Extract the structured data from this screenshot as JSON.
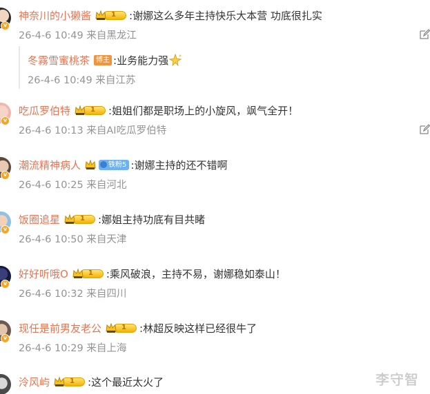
{
  "comments": [
    {
      "user": "神奈川的小獭酱",
      "level": "1",
      "text": ":谢娜这么多年主持快乐大本营 功底很扎实",
      "time": "26-4-6 10:49",
      "location": "来自黑龙江",
      "reply": {
        "user": "冬霧雪蜜桃茶",
        "badge": "博主",
        "text": ":业务能力强",
        "time": "26-4-6 10:49",
        "location": "来自江苏"
      }
    },
    {
      "user": "吃瓜罗伯特",
      "level": "1",
      "text": ":姐姐们都是职场上的小旋风，飒气全开！",
      "time": "26-4-6 10:13",
      "location": "来自AI吃瓜罗伯特"
    },
    {
      "user": "潮流精神病人",
      "fan_badge": "铁粉5",
      "text": ":谢娜主持的还不错啊",
      "time": "26-4-6 10:25",
      "location": "来自河北"
    },
    {
      "user": "饭圈追星",
      "level": "1",
      "text": ":娜姐主持功底有目共睹",
      "time": "26-4-6 10:50",
      "location": "来自天津"
    },
    {
      "user": "好好听哦O",
      "level": "1",
      "text": ":乘风破浪，主持不易，谢娜稳如泰山！",
      "time": "26-4-6 10:32",
      "location": "来自四川"
    },
    {
      "user": "现任是前男友老公",
      "level": "1",
      "text": ":林超反映这样已经很牛了",
      "time": "26-4-6 10:29",
      "location": "来自上海"
    },
    {
      "user": "泠风屿",
      "level": "1",
      "text": ":这个最近太火了"
    }
  ],
  "watermark": "李守智",
  "colors": {
    "username": "#eb7350",
    "meta": "#939393",
    "text": "#333333"
  },
  "icons": {
    "edit": "edit-icon",
    "verified": "v-badge-icon",
    "crown": "crown-icon",
    "sticker": "sparkle-sticker-icon"
  }
}
